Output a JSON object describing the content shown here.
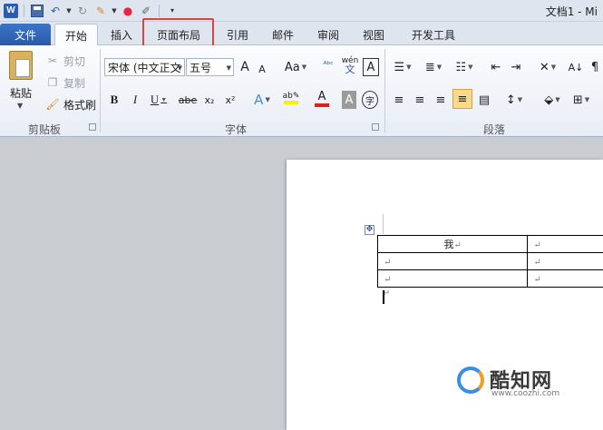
{
  "title_bar": {
    "app_icon": "word-icon",
    "app_icon_letter": "W",
    "window_title": "文档1 - Mi"
  },
  "tabs": [
    {
      "label": "文件",
      "name": "tab-file"
    },
    {
      "label": "开始",
      "name": "tab-home",
      "active": true
    },
    {
      "label": "插入",
      "name": "tab-insert"
    },
    {
      "label": "页面布局",
      "name": "tab-page-layout",
      "highlighted": true
    },
    {
      "label": "引用",
      "name": "tab-references"
    },
    {
      "label": "邮件",
      "name": "tab-mailings"
    },
    {
      "label": "审阅",
      "name": "tab-review"
    },
    {
      "label": "视图",
      "name": "tab-view"
    },
    {
      "label": "开发工具",
      "name": "tab-developer"
    }
  ],
  "clipboard": {
    "paste_label": "粘贴",
    "cut_label": "剪切",
    "copy_label": "复制",
    "format_painter_label": "格式刷",
    "group_label": "剪贴板"
  },
  "font": {
    "font_name": "宋体 (中文正文",
    "font_size": "五号",
    "group_label": "字体",
    "bold": "B",
    "italic": "I",
    "underline": "U",
    "strikethrough": "abe",
    "subscript": "x₂",
    "superscript": "x²",
    "grow": "A",
    "shrink": "A",
    "change_case": "Aa",
    "pinyin": "wén",
    "char_border": "A",
    "font_color": "A",
    "char_shading": "A",
    "enclose": "字"
  },
  "paragraph": {
    "group_label": "段落"
  },
  "document": {
    "table": [
      [
        "我",
        ""
      ],
      [
        "",
        ""
      ],
      [
        "",
        ""
      ]
    ],
    "paragraph_mark": "↵"
  },
  "watermark": {
    "brand": "酷知网",
    "url": "www.coozhi.com"
  },
  "colors": {
    "file_tab": "#2a5aa8",
    "highlight_box": "#d9453f",
    "font_color_bar": "#e0201f",
    "highlight_bar": "#ffee00"
  }
}
